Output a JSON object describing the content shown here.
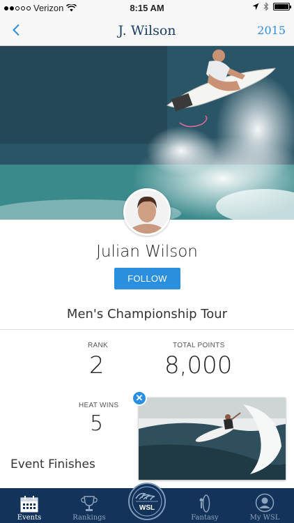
{
  "status_bar": {
    "carrier": "Verizon",
    "time": "8:15 AM",
    "signal_bars": 2
  },
  "nav": {
    "title": "J. Wilson",
    "year": "2015"
  },
  "profile": {
    "name": "Julian Wilson",
    "follow_label": "FOLLOW",
    "tour": "Men's Championship Tour"
  },
  "stats": {
    "rank_label": "RANK",
    "rank_value": "2",
    "points_label": "TOTAL POINTS",
    "points_value": "8,000",
    "heat_wins_label": "HEAT WINS",
    "heat_wins_value": "5"
  },
  "section": {
    "event_finishes": "Event Finishes"
  },
  "tabs": [
    {
      "label": "Events",
      "icon": "calendar-icon",
      "active": true
    },
    {
      "label": "Rankings",
      "icon": "trophy-icon",
      "active": false
    },
    {
      "label": "Fantasy",
      "icon": "surfboard-icon",
      "active": false
    },
    {
      "label": "My WSL",
      "icon": "user-icon",
      "active": false
    }
  ],
  "logo": {
    "text": "WSL"
  },
  "colors": {
    "accent": "#2b8fe0",
    "nav_title": "#1a3e63",
    "tab_bar": "#13335a"
  }
}
